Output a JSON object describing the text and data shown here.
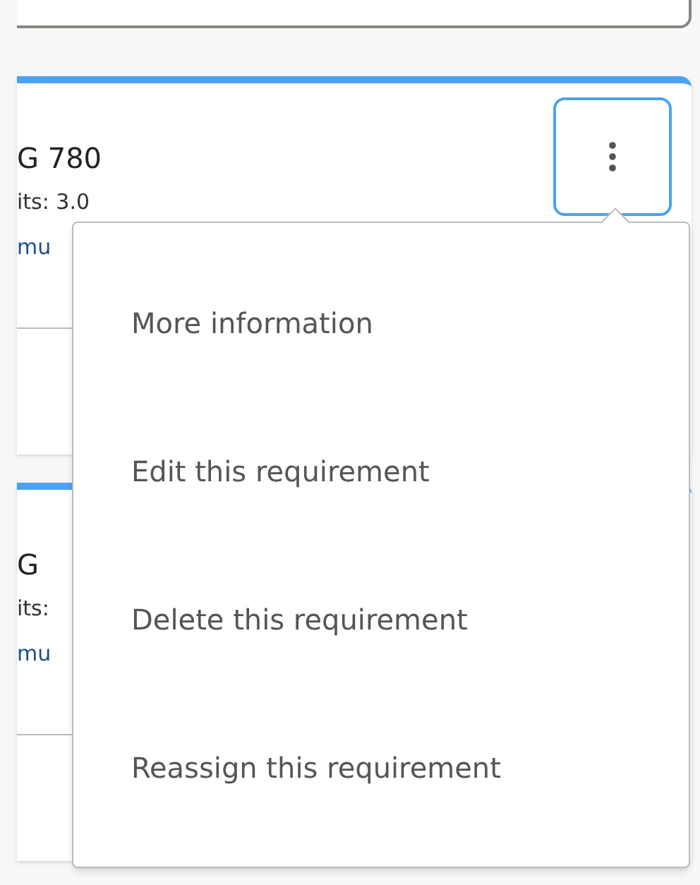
{
  "cards": [
    {
      "title": "G 780",
      "lines": [
        "its: 3.0",
        "mu"
      ]
    },
    {
      "title": "G",
      "lines": [
        "its:",
        "mu"
      ]
    }
  ],
  "menu": {
    "items": [
      {
        "label": "More information"
      },
      {
        "label": "Edit this requirement"
      },
      {
        "label": "Delete this requirement"
      },
      {
        "label": "Reassign this requirement"
      }
    ]
  }
}
